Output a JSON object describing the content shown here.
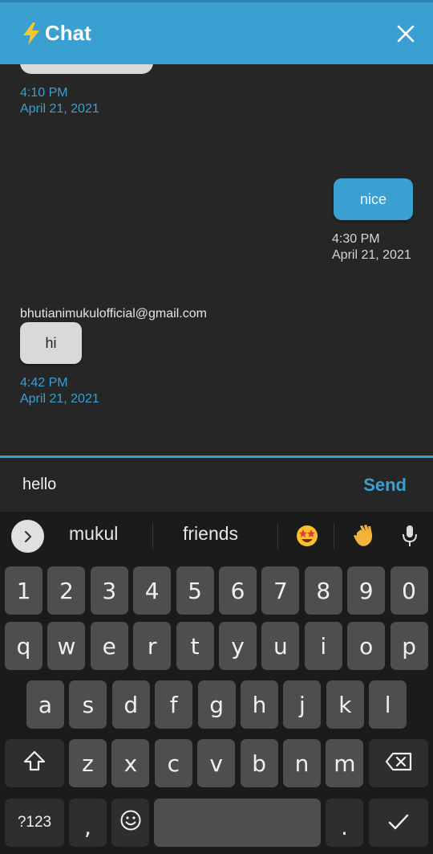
{
  "header": {
    "title": "Chat",
    "bolt_icon": "lightning-bolt-icon",
    "close_icon": "close-icon"
  },
  "colors": {
    "accent": "#3aa0d2",
    "background": "#262626",
    "keyboard": "#1b1b1b",
    "incoming_bubble": "#d9d9d9"
  },
  "messages": [
    {
      "direction": "incoming",
      "text": "",
      "time": "4:10 PM",
      "date": "April 21, 2021"
    },
    {
      "direction": "outgoing",
      "text": "nice",
      "time": "4:30 PM",
      "date": "April 21, 2021"
    },
    {
      "direction": "incoming",
      "sender": "bhutianimukulofficial@gmail.com",
      "text": "hi",
      "time": "4:42 PM",
      "date": "April 21, 2021"
    }
  ],
  "input": {
    "value": "hello",
    "send_label": "Send"
  },
  "keyboard": {
    "suggestions": [
      "mukul",
      "friends"
    ],
    "suggestion_emojis": [
      "star-struck-emoji",
      "waving-hand-emoji"
    ],
    "row_numbers": [
      "1",
      "2",
      "3",
      "4",
      "5",
      "6",
      "7",
      "8",
      "9",
      "0"
    ],
    "row_top": [
      "q",
      "w",
      "e",
      "r",
      "t",
      "y",
      "u",
      "i",
      "o",
      "p"
    ],
    "row_middle": [
      "a",
      "s",
      "d",
      "f",
      "g",
      "h",
      "j",
      "k",
      "l"
    ],
    "row_bottom": [
      "z",
      "x",
      "c",
      "v",
      "b",
      "n",
      "m"
    ],
    "symbols_label": "?123",
    "comma": ",",
    "period": "."
  }
}
